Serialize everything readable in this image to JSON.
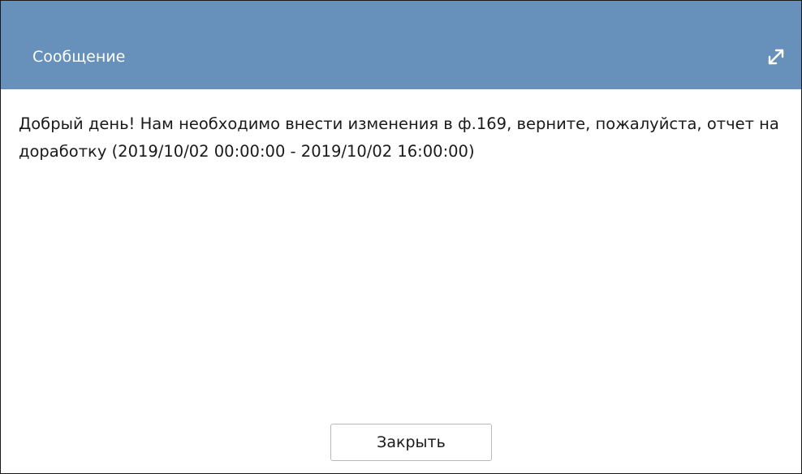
{
  "dialog": {
    "title": "Сообщение",
    "message": "Добрый день! Нам необходимо внести изменения в ф.169, верните, пожалуйста, отчет на доработку (2019/10/02 00:00:00 - 2019/10/02 16:00:00)",
    "close_label": "Закрыть",
    "expand_icon": "expand-icon"
  },
  "colors": {
    "titlebar": "#6790bb",
    "title_text": "#ffffff",
    "border": "#1a1a1a"
  }
}
